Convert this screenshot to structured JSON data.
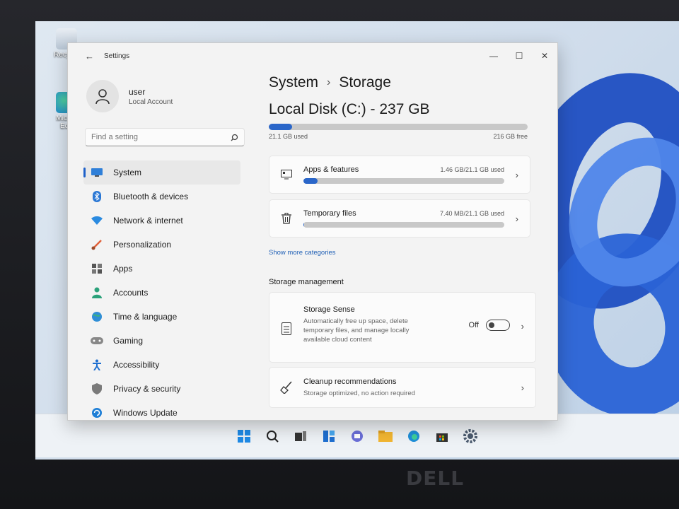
{
  "window": {
    "title": "Settings",
    "back_glyph": "←",
    "min_glyph": "—",
    "max_glyph": "☐",
    "close_glyph": "✕"
  },
  "profile": {
    "name": "user",
    "subtitle": "Local Account"
  },
  "search": {
    "placeholder": "Find a setting"
  },
  "nav": [
    {
      "label": "System",
      "icon": "monitor-icon",
      "selected": true
    },
    {
      "label": "Bluetooth & devices",
      "icon": "bluetooth-icon"
    },
    {
      "label": "Network & internet",
      "icon": "wifi-icon"
    },
    {
      "label": "Personalization",
      "icon": "brush-icon"
    },
    {
      "label": "Apps",
      "icon": "apps-icon"
    },
    {
      "label": "Accounts",
      "icon": "person-icon"
    },
    {
      "label": "Time & language",
      "icon": "globe-icon"
    },
    {
      "label": "Gaming",
      "icon": "controller-icon"
    },
    {
      "label": "Accessibility",
      "icon": "accessibility-icon"
    },
    {
      "label": "Privacy & security",
      "icon": "shield-icon"
    },
    {
      "label": "Windows Update",
      "icon": "update-icon"
    }
  ],
  "breadcrumb": {
    "parent": "System",
    "separator": "›",
    "current": "Storage"
  },
  "disk": {
    "title": "Local Disk (C:) - 237 GB",
    "used_label": "21.1 GB used",
    "free_label": "216 GB free",
    "used_fraction": 0.089
  },
  "categories": [
    {
      "title": "Apps & features",
      "value": "1.46 GB/21.1 GB used",
      "fraction": 0.069,
      "icon": "apps-features-icon"
    },
    {
      "title": "Temporary files",
      "value": "7.40 MB/21.1 GB used",
      "fraction": 0.0003,
      "icon": "trash-icon"
    }
  ],
  "show_more": "Show more categories",
  "management": {
    "heading": "Storage management",
    "sense": {
      "title": "Storage Sense",
      "description": "Automatically free up space, delete temporary files, and manage locally available cloud content",
      "toggle_label": "Off",
      "enabled": false
    },
    "cleanup": {
      "title": "Cleanup recommendations",
      "subtitle": "Storage optimized, no action required"
    }
  },
  "desktop": {
    "icons": [
      {
        "label": "Recycle"
      },
      {
        "label": "Micros Edg"
      }
    ]
  },
  "taskbar": [
    "start-icon",
    "search-icon",
    "task-view-icon",
    "widgets-icon",
    "chat-icon",
    "file-explorer-icon",
    "edge-icon",
    "store-icon",
    "settings-icon"
  ],
  "colors": {
    "accent": "#2a66c9",
    "wallpaper_bloom": "#2356c8"
  },
  "brand": "DELL"
}
